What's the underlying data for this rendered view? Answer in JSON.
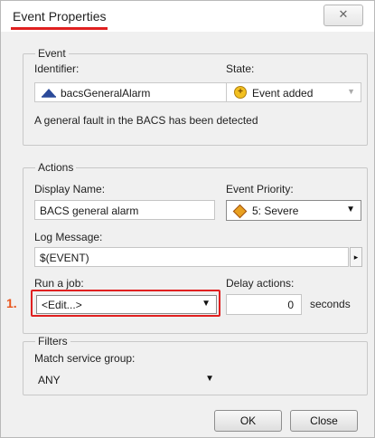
{
  "dialog": {
    "title": "Event Properties",
    "close_glyph": "✕"
  },
  "event": {
    "legend": "Event",
    "identifier_label": "Identifier:",
    "identifier_value": "bacsGeneralAlarm",
    "state_label": "State:",
    "state_value": "Event added",
    "description": "A general fault in the BACS has been detected"
  },
  "actions": {
    "legend": "Actions",
    "display_name_label": "Display Name:",
    "display_name_value": "BACS general alarm",
    "priority_label": "Event Priority:",
    "priority_value": "5: Severe",
    "log_message_label": "Log Message:",
    "log_message_value": "$(EVENT)",
    "log_message_button": "▸",
    "run_job_label": "Run a job:",
    "run_job_value": "<Edit...>",
    "step_marker": "1.",
    "delay_label": "Delay actions:",
    "delay_value": "0",
    "delay_unit": "seconds"
  },
  "filters": {
    "legend": "Filters",
    "match_label": "Match service group:",
    "match_value": "ANY"
  },
  "buttons": {
    "ok": "OK",
    "close": "Close"
  },
  "colors": {
    "annotation_red": "#e02020",
    "step_orange": "#e8561e"
  }
}
